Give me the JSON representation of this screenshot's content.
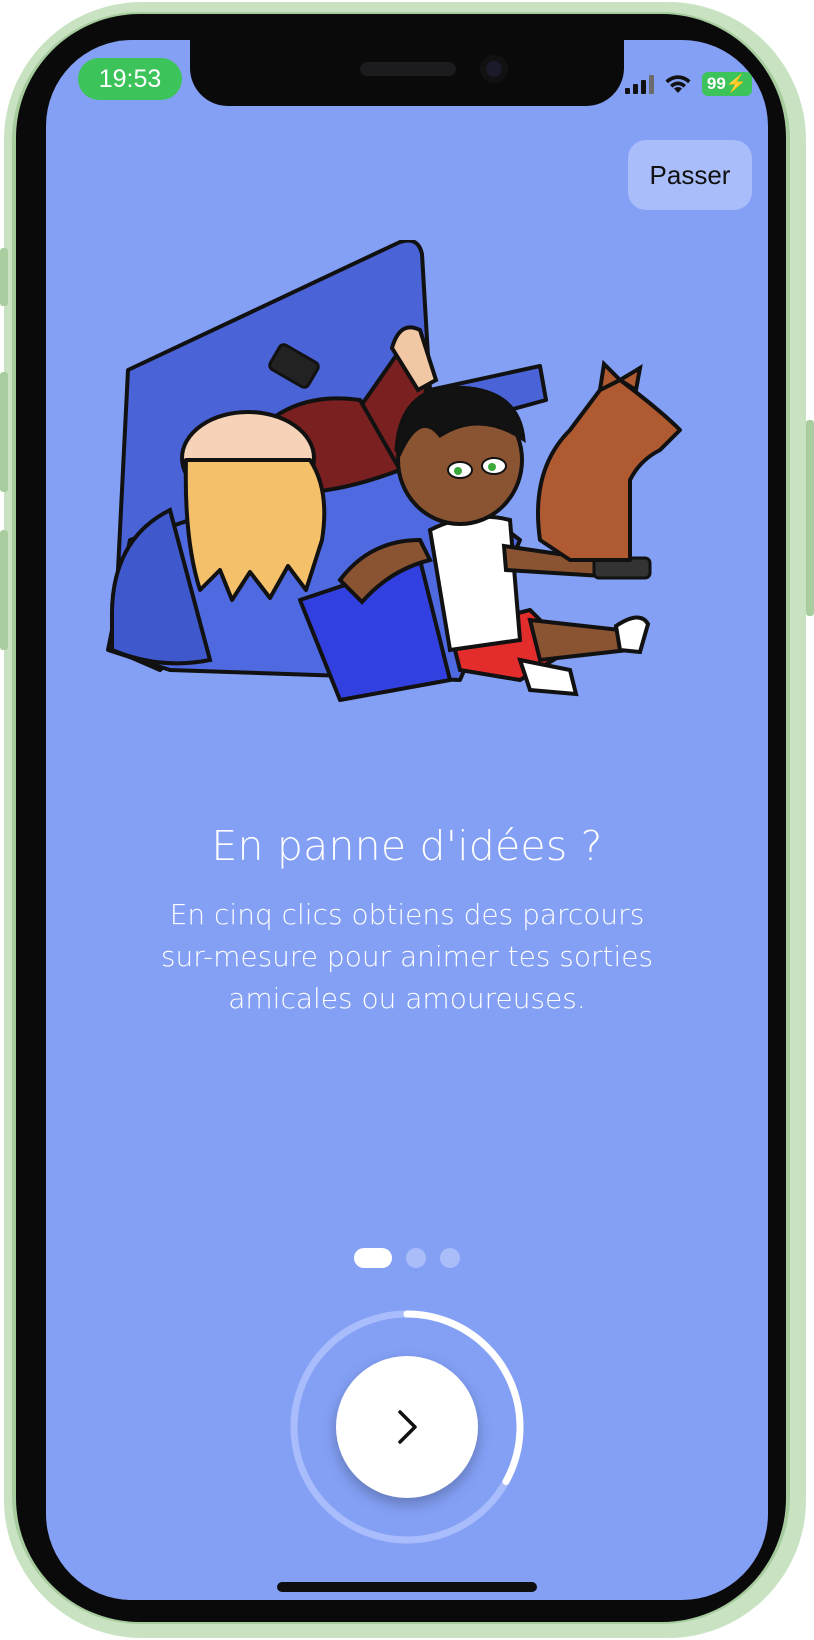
{
  "status_bar": {
    "time": "19:53",
    "battery": "99",
    "icons": [
      "signal-icon",
      "wifi-icon",
      "battery-icon"
    ]
  },
  "header": {
    "skip_label": "Passer"
  },
  "slide": {
    "title": "En panne d'idées ?",
    "description_lines": [
      "En cinq clics obtiens des parcours",
      "sur-mesure pour animer tes sorties",
      "amicales ou amoureuses."
    ],
    "illustration_icon": "couch-friends-dog-illustration"
  },
  "pager": {
    "total": 3,
    "current": 1
  },
  "next_button": {
    "icon": "chevron-right-icon",
    "progress_fraction": 0.33
  },
  "colors": {
    "background": "#84a0f5",
    "accent_green": "#3cc45a",
    "white": "#ffffff"
  }
}
